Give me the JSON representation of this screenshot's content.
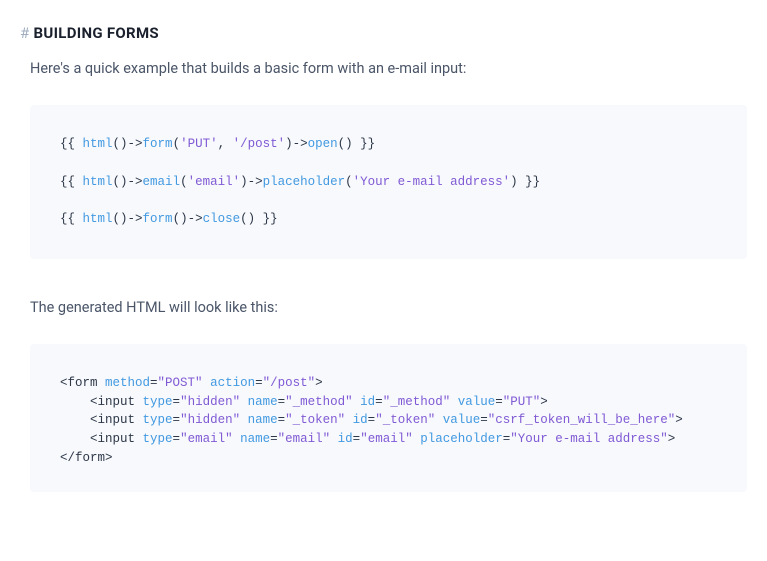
{
  "heading": "BUILDING FORMS",
  "intro": "Here's a quick example that builds a basic form with an e-mail input:",
  "code1": {
    "l1": {
      "open": "{{ ",
      "fn1": "html",
      "p1": "()->",
      "fn2": "form",
      "p2": "(",
      "s1": "'PUT'",
      "c": ", ",
      "s2": "'/post'",
      "p3": ")->",
      "fn3": "open",
      "p4": "() }}"
    },
    "l2": {
      "open": "{{ ",
      "fn1": "html",
      "p1": "()->",
      "fn2": "email",
      "p2": "(",
      "s1": "'email'",
      "p3": ")->",
      "fn3": "placeholder",
      "p4": "(",
      "s2": "'Your e-mail address'",
      "p5": ") }}"
    },
    "l3": {
      "open": "{{ ",
      "fn1": "html",
      "p1": "()->",
      "fn2": "form",
      "p2": "()->",
      "fn3": "close",
      "p3": "() }}"
    }
  },
  "outro": "The generated HTML will look like this:",
  "code2": {
    "l1": {
      "a": "<form ",
      "k1": "method",
      "e": "=",
      "v1": "\"POST\"",
      "sp": " ",
      "k2": "action",
      "v2": "\"/post\"",
      "b": ">"
    },
    "l2": {
      "ind": "    ",
      "a": "<input ",
      "k1": "type",
      "e": "=",
      "v1": "\"hidden\"",
      "sp": " ",
      "k2": "name",
      "v2": "\"_method\"",
      "k3": "id",
      "v3": "\"_method\"",
      "k4": "value",
      "v4": "\"PUT\"",
      "b": ">"
    },
    "l3": {
      "ind": "    ",
      "a": "<input ",
      "k1": "type",
      "e": "=",
      "v1": "\"hidden\"",
      "sp": " ",
      "k2": "name",
      "v2": "\"_token\"",
      "k3": "id",
      "v3": "\"_token\"",
      "k4": "value",
      "v4": "\"csrf_token_will_be_here\"",
      "b": ">"
    },
    "l4": {
      "ind": "    ",
      "a": "<input ",
      "k1": "type",
      "e": "=",
      "v1": "\"email\"",
      "sp": " ",
      "k2": "name",
      "v2": "\"email\"",
      "k3": "id",
      "v3": "\"email\"",
      "k4": "placeholder",
      "v4": "\"Your e-mail address\"",
      "b": ">"
    },
    "l5": {
      "a": "</form>"
    }
  }
}
